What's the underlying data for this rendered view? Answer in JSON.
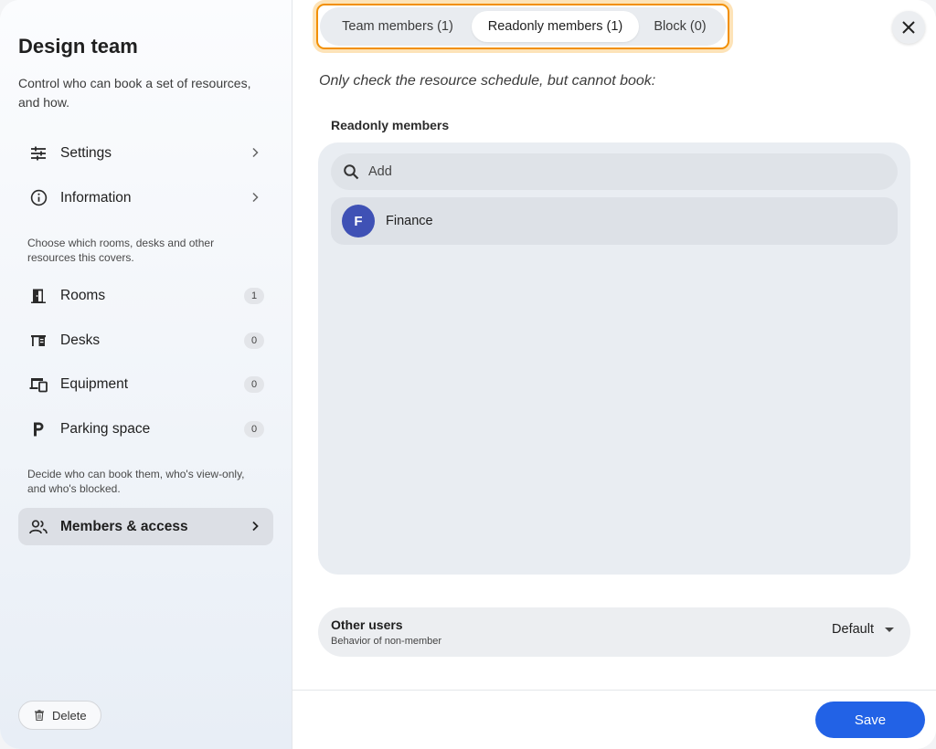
{
  "sidebar": {
    "title": "Design team",
    "description": "Control who can book a set of resources, and how.",
    "nav_top": [
      {
        "label": "Settings",
        "icon": "sliders-icon"
      },
      {
        "label": "Information",
        "icon": "info-icon"
      }
    ],
    "hint_resources": "Choose which rooms, desks and other resources this covers.",
    "resources": [
      {
        "label": "Rooms",
        "count": "1",
        "icon": "door-icon"
      },
      {
        "label": "Desks",
        "count": "0",
        "icon": "desk-icon"
      },
      {
        "label": "Equipment",
        "count": "0",
        "icon": "devices-icon"
      },
      {
        "label": "Parking space",
        "count": "0",
        "icon": "parking-icon"
      }
    ],
    "hint_members": "Decide who can book them, who's view-only, and who's blocked.",
    "members_access": {
      "label": "Members & access",
      "icon": "people-icon"
    },
    "delete_label": "Delete"
  },
  "tabs": [
    {
      "label": "Team members (1)",
      "active": false
    },
    {
      "label": "Readonly members (1)",
      "active": true
    },
    {
      "label": "Block (0)",
      "active": false
    }
  ],
  "main": {
    "subtitle": "Only check the resource schedule, but cannot book:",
    "section_label": "Readonly members",
    "search_placeholder": "Add",
    "members": [
      {
        "initial": "F",
        "name": "Finance",
        "avatar_color": "#3f51b5"
      }
    ],
    "other_users": {
      "title": "Other users",
      "subtitle": "Behavior of non-member",
      "value": "Default"
    },
    "save_label": "Save"
  },
  "colors": {
    "accent": "#2262e6",
    "highlight": "#f28f00",
    "avatar": "#3f51b5"
  }
}
